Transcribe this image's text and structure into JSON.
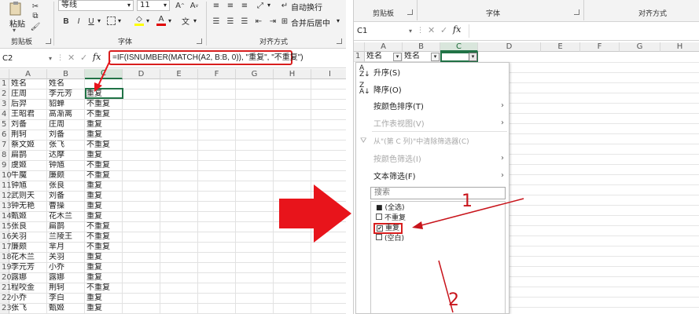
{
  "left": {
    "ribbon": {
      "paste_label": "粘贴",
      "font_name": "等线",
      "font_size": "11",
      "bold": "B",
      "italic": "I",
      "underline": "U",
      "wrap_text": "自动换行",
      "merge_center": "合并后居中",
      "group_clipboard": "剪贴板",
      "group_font": "字体",
      "group_align": "对齐方式"
    },
    "namebox": "C2",
    "formula": "=IF(ISNUMBER(MATCH(A2, B:B, 0)), \"重复\", \"不重复\")",
    "columns": [
      "A",
      "B",
      "C",
      "D",
      "E",
      "F",
      "G",
      "H",
      "I"
    ],
    "rows": [
      [
        "1",
        "姓名",
        "姓名",
        ""
      ],
      [
        "2",
        "庄周",
        "李元芳",
        "重复"
      ],
      [
        "3",
        "后羿",
        "貂蝉",
        "不重复"
      ],
      [
        "4",
        "王昭君",
        "高渐离",
        "不重复"
      ],
      [
        "5",
        "刘备",
        "庄周",
        "重复"
      ],
      [
        "6",
        "荆轲",
        "刘备",
        "重复"
      ],
      [
        "7",
        "蔡文姬",
        "张飞",
        "不重复"
      ],
      [
        "8",
        "扁鹊",
        "达摩",
        "重复"
      ],
      [
        "9",
        "虞姬",
        "钟馗",
        "不重复"
      ],
      [
        "10",
        "牛魔",
        "廉颇",
        "不重复"
      ],
      [
        "11",
        "钟馗",
        "张良",
        "重复"
      ],
      [
        "12",
        "武则天",
        "刘备",
        "重复"
      ],
      [
        "13",
        "钟无艳",
        "曹操",
        "重复"
      ],
      [
        "14",
        "甄姬",
        "花木兰",
        "重复"
      ],
      [
        "15",
        "张良",
        "扁鹊",
        "不重复"
      ],
      [
        "16",
        "关羽",
        "兰陵王",
        "不重复"
      ],
      [
        "17",
        "廉颇",
        "芈月",
        "不重复"
      ],
      [
        "18",
        "花木兰",
        "关羽",
        "重复"
      ],
      [
        "19",
        "李元芳",
        "小乔",
        "重复"
      ],
      [
        "20",
        "露娜",
        "露娜",
        "重复"
      ],
      [
        "21",
        "程咬金",
        "荆轲",
        "不重复"
      ],
      [
        "22",
        "小乔",
        "李白",
        "重复"
      ],
      [
        "23",
        "张飞",
        "甄姬",
        "重复"
      ]
    ]
  },
  "right": {
    "ribbon": {
      "group_clipboard": "剪贴板",
      "group_font": "字体",
      "group_align": "对齐方式"
    },
    "namebox": "C1",
    "columns": [
      "A",
      "B",
      "C",
      "D",
      "E",
      "F",
      "G",
      "H"
    ],
    "headers": [
      "姓名",
      "姓名",
      ""
    ],
    "menu": {
      "sort_asc": "升序(S)",
      "sort_desc": "降序(O)",
      "sort_color": "按颜色排序(T)",
      "sheet_view": "工作表视图(V)",
      "clear_filter": "从\"(第 C 列)\"中清除筛选器(C)",
      "filter_color": "按颜色筛选(I)",
      "text_filter": "文本筛选(F)",
      "search_placeholder": "搜索",
      "options": [
        {
          "label": "(全选)",
          "state": "■"
        },
        {
          "label": "不重复",
          "state": ""
        },
        {
          "label": "重复",
          "state": "✔"
        },
        {
          "label": "(空白)",
          "state": ""
        }
      ]
    },
    "annotations": {
      "one": "1",
      "two": "2"
    }
  },
  "colors": {
    "accent": "#217346",
    "arrow": "#e8141b",
    "header_bg": "#f0f0f0"
  }
}
